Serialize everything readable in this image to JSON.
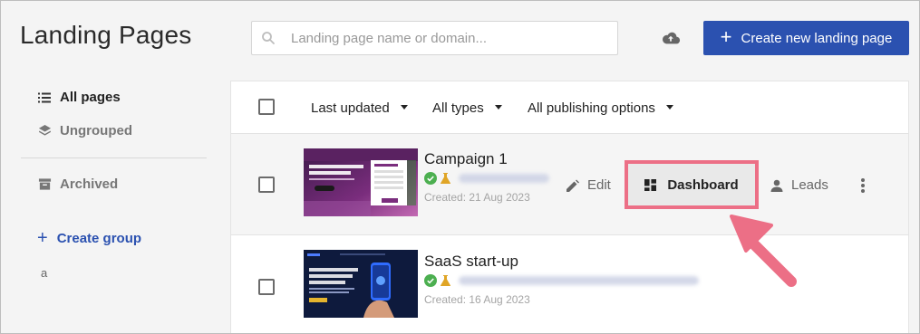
{
  "header": {
    "title": "Landing Pages",
    "search_placeholder": "Landing page name or domain...",
    "create_label": "Create new landing page"
  },
  "sidebar": {
    "items": [
      {
        "label": "All pages",
        "icon": "list-icon"
      },
      {
        "label": "Ungrouped",
        "icon": "layers-icon"
      },
      {
        "label": "Archived",
        "icon": "archive-icon"
      }
    ],
    "create_group_label": "Create group",
    "groups": [
      "a"
    ]
  },
  "filters": {
    "sort": "Last updated",
    "types": "All types",
    "publishing": "All publishing options"
  },
  "rows": [
    {
      "title": "Campaign 1",
      "created": "Created: 21 Aug 2023",
      "actions": {
        "edit": "Edit",
        "dashboard": "Dashboard",
        "leads": "Leads"
      }
    },
    {
      "title": "SaaS start-up",
      "created": "Created: 16 Aug 2023"
    }
  ],
  "colors": {
    "accent": "#2b51b0",
    "highlight": "#ec6f86",
    "status_green": "#4caf50",
    "status_amber": "#e0a526"
  }
}
